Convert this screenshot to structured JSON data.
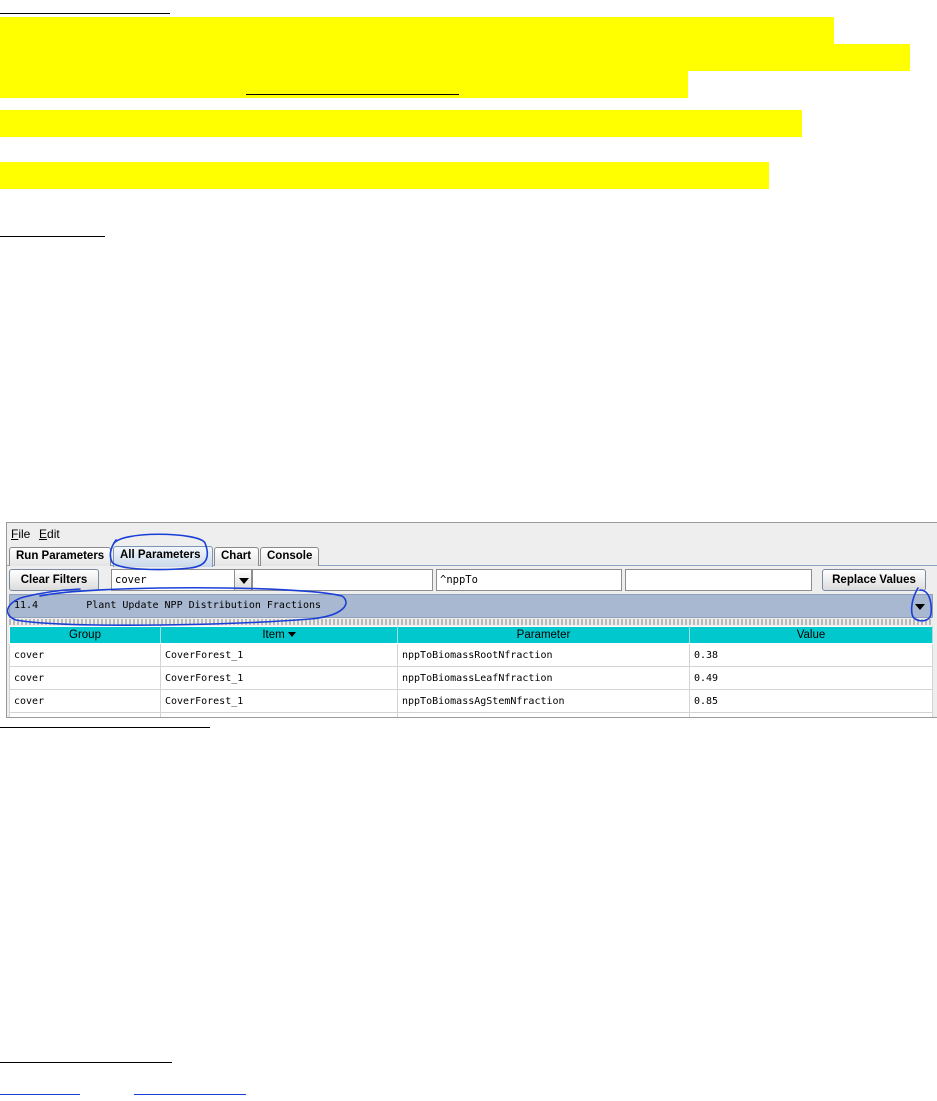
{
  "app": {
    "menu": [
      {
        "mnemonic": "F",
        "rest": "ile"
      },
      {
        "mnemonic": "E",
        "rest": "dit"
      }
    ],
    "tabs": [
      "Run Parameters",
      "All Parameters",
      "Chart",
      "Console"
    ],
    "active_tab": "All Parameters",
    "filter_bar": {
      "clear_label": "Clear Filters",
      "group_filter_value": "cover",
      "item_filter_value": "",
      "parameter_filter_value": "^nppTo",
      "value_filter_value": "",
      "replace_label": "Replace Values"
    },
    "section": {
      "number": "11.4",
      "title": "Plant Update NPP Distribution Fractions"
    },
    "table": {
      "columns": [
        "Group",
        "Item",
        "Parameter",
        "Value"
      ],
      "sorted_column": "Item",
      "rows": [
        [
          "cover",
          "CoverForest_1",
          "nppToBiomassRootNfraction",
          "0.38"
        ],
        [
          "cover",
          "CoverForest_1",
          "nppToBiomassLeafNfraction",
          "0.49"
        ],
        [
          "cover",
          "CoverForest_1",
          "nppToBiomassAgStemNfraction",
          "0.85"
        ]
      ]
    }
  },
  "colors": {
    "highlight": "#ffff00",
    "table_header": "#00c8cc",
    "section_bar": "#a8b8d0",
    "annotation_ink": "#1a3fd6"
  }
}
